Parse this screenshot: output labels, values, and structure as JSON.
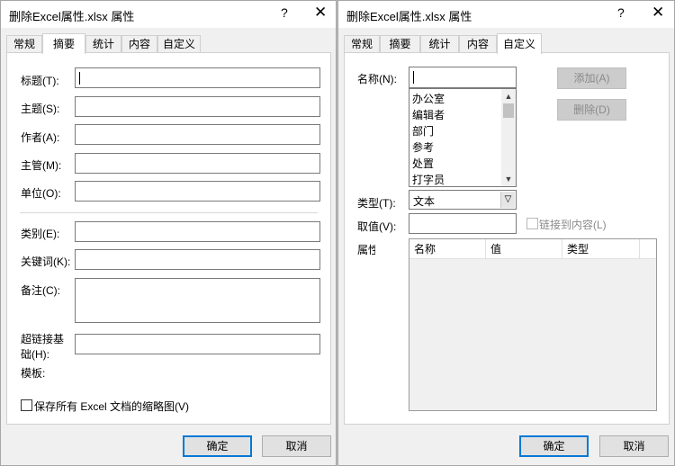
{
  "left_dialog": {
    "title": "删除Excel属性.xlsx 属性",
    "help": "?",
    "close": "✕",
    "tabs": [
      "常规",
      "摘要",
      "统计",
      "内容",
      "自定义"
    ],
    "fields": [
      {
        "label": "标题(T):",
        "value": ""
      },
      {
        "label": "主题(S):",
        "value": ""
      },
      {
        "label": "作者(A):",
        "value": ""
      },
      {
        "label": "主管(M):",
        "value": ""
      },
      {
        "label": "单位(O):",
        "value": ""
      }
    ],
    "fields2": [
      {
        "label": "类别(E):",
        "value": ""
      },
      {
        "label": "关键词(K):",
        "value": ""
      },
      {
        "label": "备注(C):",
        "value": ""
      }
    ],
    "hyperlink_label_line1": "超链接基",
    "hyperlink_label_line2": "础(H):",
    "template_label": "模板:",
    "save_thumbnail_label": "保存所有 Excel 文档的缩略图(V)",
    "ok": "确定",
    "cancel": "取消"
  },
  "right_dialog": {
    "title": "删除Excel属性.xlsx 属性",
    "help": "?",
    "close": "✕",
    "tabs": [
      "常规",
      "摘要",
      "统计",
      "内容",
      "自定义"
    ],
    "name_label": "名称(N):",
    "name_value": "",
    "name_options": [
      "办公室",
      "编辑者",
      "部门",
      "参考",
      "处置",
      "打字员"
    ],
    "add_button": "添加(A)",
    "delete_button": "删除(D)",
    "type_label": "类型(T):",
    "type_value": "文本",
    "value_label": "取值(V):",
    "value_value": "",
    "link_label": "链接到内容(L)",
    "properties_label": "属性(P):",
    "grid_columns": [
      "名称",
      "值",
      "类型"
    ],
    "ok": "确定",
    "cancel": "取消"
  }
}
